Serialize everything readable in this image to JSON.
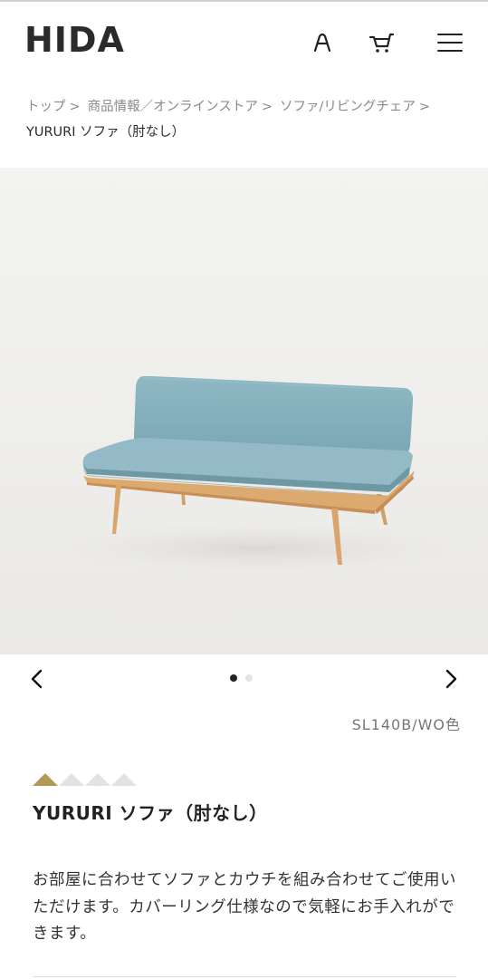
{
  "header": {
    "logo": "HIDA",
    "icons": [
      "user-icon",
      "cart-icon",
      "menu-icon"
    ]
  },
  "breadcrumb": {
    "items": [
      "トップ",
      "商品情報／オンラインストア",
      "ソファ/リビングチェア"
    ],
    "separator": ">",
    "current": "YURURI ソファ（肘なし）"
  },
  "carousel": {
    "slide_count": 2,
    "active_index": 0
  },
  "product": {
    "variant": "SL140B/WO色",
    "rating": {
      "filled": 1,
      "total": 4
    },
    "title": "YURURI ソファ（肘なし）",
    "description": "お部屋に合わせてソファとカウチを組み合わせてご使用いただけます。カバーリング仕様なので気軽にお手入れができます。"
  },
  "colors": {
    "rating_filled": "#b29a56",
    "rating_empty": "#e2e2e2",
    "fabric": "#86b0bd",
    "wood": "#d9a66a"
  }
}
